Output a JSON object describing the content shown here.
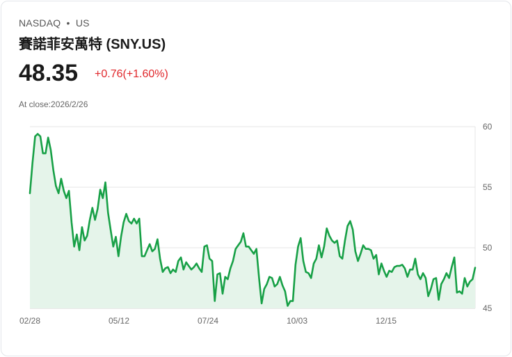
{
  "header": {
    "exchange": "NASDAQ",
    "separator": "•",
    "market": "US",
    "title": "賽諾菲安萬特 (SNY.US)",
    "price": "48.35",
    "change": "+0.76(+1.60%)",
    "close_label": "At close:2026/2/26"
  },
  "colors": {
    "line": "#17a046",
    "fill": "#e5f4ea",
    "change": "#e0262a",
    "grid": "#e6e6e6"
  },
  "chart_data": {
    "type": "area",
    "title": "SNY.US price",
    "ylim": [
      45,
      60
    ],
    "yticks": [
      60,
      55,
      50,
      45
    ],
    "xticks": [
      {
        "label": "02/28",
        "pos": 0
      },
      {
        "label": "05/12",
        "pos": 0.2
      },
      {
        "label": "07/24",
        "pos": 0.4
      },
      {
        "label": "10/03",
        "pos": 0.6
      },
      {
        "label": "12/15",
        "pos": 0.8
      }
    ],
    "values": [
      54.5,
      57.0,
      59.2,
      59.4,
      59.2,
      57.8,
      57.8,
      59.1,
      58.1,
      56.4,
      55.1,
      54.5,
      55.7,
      54.7,
      54.1,
      54.7,
      52.1,
      50.1,
      51.1,
      49.8,
      51.7,
      50.6,
      51.0,
      52.3,
      53.3,
      52.3,
      53.2,
      54.8,
      54.1,
      55.4,
      52.9,
      51.5,
      50.1,
      50.9,
      49.3,
      50.9,
      52.1,
      52.8,
      52.2,
      52.0,
      52.4,
      52.0,
      52.4,
      49.3,
      49.3,
      49.8,
      50.3,
      49.7,
      49.9,
      50.7,
      49.1,
      48.0,
      48.3,
      48.4,
      47.9,
      48.2,
      48.0,
      48.9,
      49.2,
      48.2,
      48.8,
      48.5,
      48.2,
      48.4,
      48.7,
      48.3,
      48.0,
      50.1,
      50.2,
      49.1,
      48.9,
      45.6,
      47.8,
      47.9,
      46.2,
      47.6,
      47.4,
      48.3,
      48.9,
      49.9,
      50.2,
      50.5,
      51.2,
      50.1,
      50.1,
      49.8,
      49.5,
      49.9,
      47.5,
      45.4,
      46.6,
      47.0,
      47.6,
      47.5,
      46.8,
      47.0,
      47.6,
      46.9,
      46.4,
      45.2,
      45.6,
      45.6,
      48.6,
      50.1,
      50.8,
      48.9,
      48.0,
      47.9,
      47.5,
      48.7,
      49.1,
      50.2,
      49.2,
      50.1,
      51.6,
      51.0,
      50.6,
      50.4,
      50.6,
      49.3,
      49.1,
      50.6,
      51.8,
      52.2,
      51.5,
      49.7,
      48.9,
      49.5,
      50.2,
      49.9,
      49.9,
      49.8,
      49.1,
      49.4,
      47.8,
      48.7,
      48.1,
      47.6,
      48.1,
      48.0,
      48.4,
      48.5,
      48.5,
      48.6,
      48.3,
      47.6,
      48.2,
      48.2,
      49.1,
      47.8,
      47.4,
      47.9,
      47.5,
      46.0,
      46.6,
      47.4,
      47.5,
      45.7,
      47.0,
      47.4,
      47.9,
      47.5,
      48.4,
      49.2,
      46.3,
      46.4,
      46.2,
      47.5,
      46.8,
      47.2,
      47.4,
      48.35
    ]
  }
}
